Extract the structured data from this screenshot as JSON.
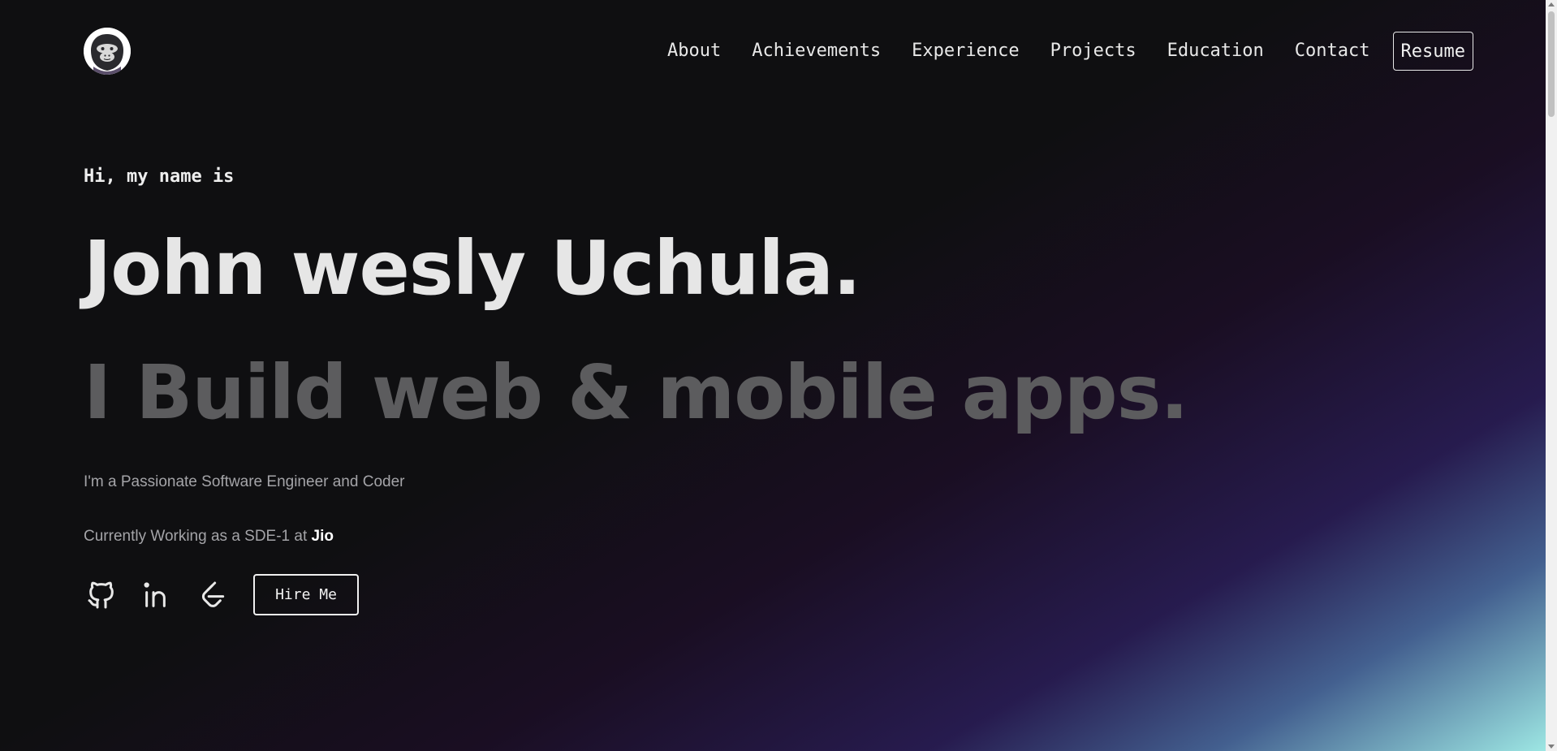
{
  "header": {
    "logo_icon": "gorilla-avatar-icon",
    "nav": [
      {
        "label": "About"
      },
      {
        "label": "Achievements"
      },
      {
        "label": "Experience"
      },
      {
        "label": "Projects"
      },
      {
        "label": "Education"
      },
      {
        "label": "Contact"
      }
    ],
    "resume_label": "Resume"
  },
  "hero": {
    "greeting": "Hi, my name is",
    "name": "John wesly Uchula.",
    "tagline": "I Build web & mobile apps.",
    "intro": "I'm a Passionate Software Engineer and Coder",
    "current_prefix": "Currently Working as a SDE-1 at ",
    "company": "Jio",
    "social": [
      {
        "icon": "github-icon"
      },
      {
        "icon": "linkedin-icon"
      },
      {
        "icon": "leetcode-icon"
      }
    ],
    "hire_label": "Hire Me"
  },
  "colors": {
    "background": "#0f0f11",
    "text": "#e6e6e6",
    "tagline": "#5c5c5e",
    "muted": "#a4a4a8",
    "gradient_accent": "#a0ebe6"
  }
}
